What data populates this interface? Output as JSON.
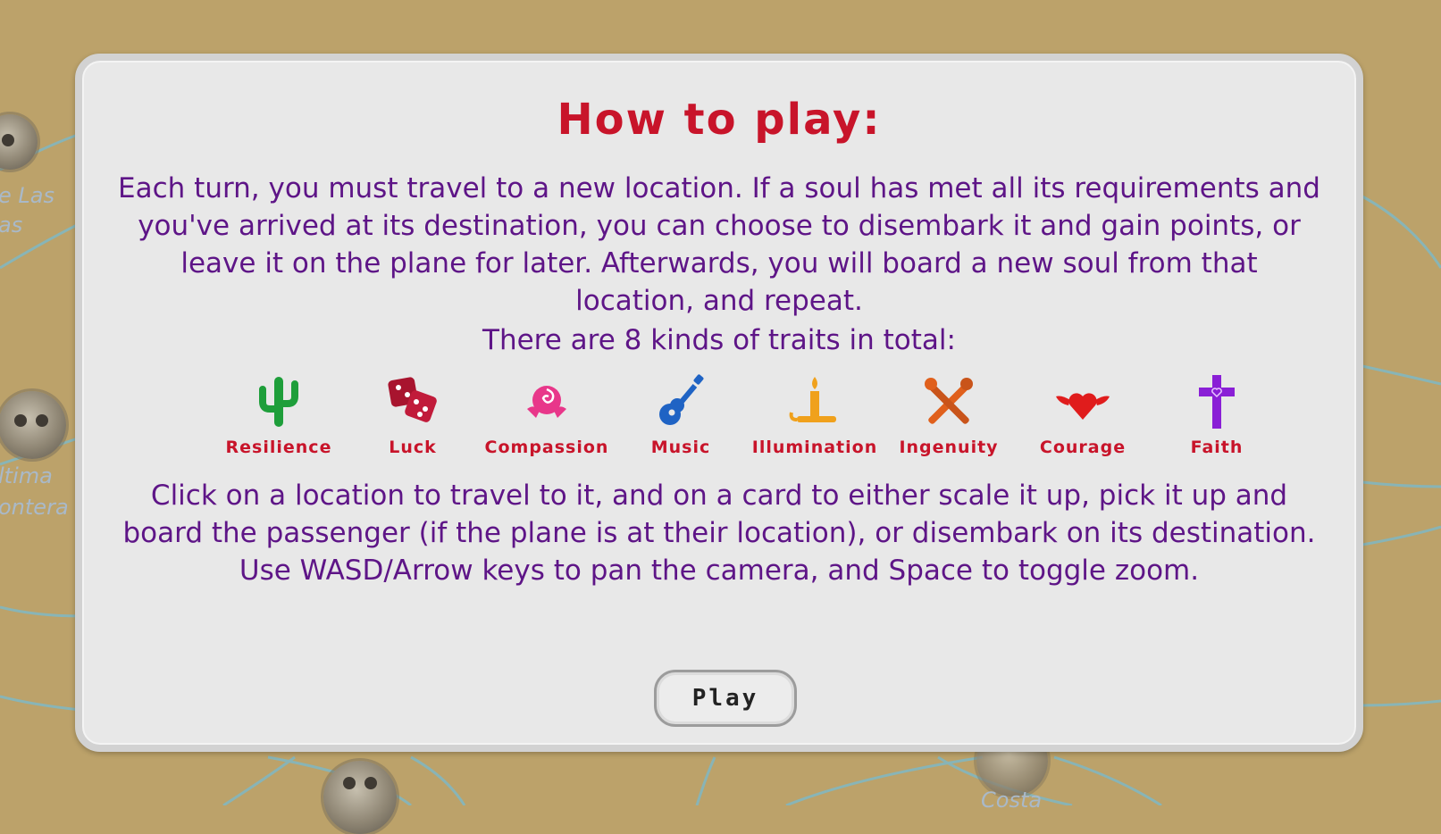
{
  "title": "How to play:",
  "intro": "Each turn, you must travel to a new location. If a soul has met all its requirements and you've arrived at its destination, you can choose to disembark it and gain points, or leave it on the plane for later. Afterwards, you will board a new soul from that location, and repeat.",
  "traits_heading": "There are 8 kinds of traits in total:",
  "traits": [
    {
      "label": "Resilience",
      "icon": "cactus-icon",
      "color": "#1e9e3a"
    },
    {
      "label": "Luck",
      "icon": "dice-icon",
      "color": "#a8142e"
    },
    {
      "label": "Compassion",
      "icon": "rose-icon",
      "color": "#e8378a"
    },
    {
      "label": "Music",
      "icon": "guitar-icon",
      "color": "#1f63c4"
    },
    {
      "label": "Illumination",
      "icon": "candle-icon",
      "color": "#f0a11c"
    },
    {
      "label": "Ingenuity",
      "icon": "tools-icon",
      "color": "#e0601c"
    },
    {
      "label": "Courage",
      "icon": "winged-heart-icon",
      "color": "#e01c1c"
    },
    {
      "label": "Faith",
      "icon": "cross-icon",
      "color": "#8a1fd6"
    }
  ],
  "controls": "Click on a location to travel to it, and on a card to either scale it up, pick it up and board the passenger (if the plane is at their location), or disembark on its destination. Use WASD/Arrow keys to pan the camera, and Space to toggle zoom.",
  "play_label": "Play",
  "map_labels": {
    "left_top_1": "e Las",
    "left_top_2": "as",
    "left_mid_1": "ltima",
    "left_mid_2": "ontera",
    "bottom_right": "Costa"
  },
  "colors": {
    "title": "#c8142a",
    "body_text": "#5e1587",
    "trait_label": "#c8142a",
    "map_background": "#bca26a",
    "map_route": "#7fb8c4"
  }
}
